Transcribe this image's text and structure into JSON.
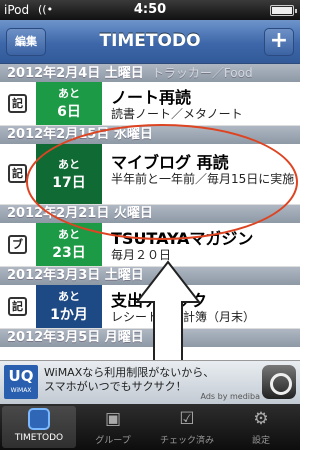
{
  "status": {
    "carrier": "iPod",
    "wifi_icon": "wifi-icon",
    "time": "4:50",
    "battery_icon": "battery-icon"
  },
  "nav": {
    "edit_label": "編集",
    "title": "TIMETODO",
    "add_label": "+"
  },
  "sections": [
    {
      "date": "2012年2月4日 土曜日",
      "overlay": "トラッカー／Food"
    },
    {
      "date": "2012年2月15日 水曜日"
    },
    {
      "date": "2012年2月21日 火曜日"
    },
    {
      "date": "2012年3月3日 土曜日"
    },
    {
      "date": "2012年3月5日 月曜日"
    }
  ],
  "items": [
    {
      "category": "記",
      "badge_top": "あと",
      "badge_value": "6日",
      "title": "ノート再読",
      "subtitle": "読書ノート／メタノート",
      "badge_color": "#1d9a46"
    },
    {
      "category": "記",
      "badge_top": "あと",
      "badge_value": "17日",
      "title": "マイブログ 再読",
      "subtitle": "半年前と一年前／毎月15日に実施",
      "badge_color": "#0f6a33"
    },
    {
      "category": "ブ",
      "badge_top": "あと",
      "badge_value": "23日",
      "title": "TSUTAYAマガジン",
      "subtitle": "毎月２０日",
      "badge_color": "#1d9a46"
    },
    {
      "category": "記",
      "badge_top": "あと",
      "badge_value": "1か月",
      "title": "支出チェック",
      "subtitle": "レシート／家計簿（月末）",
      "badge_color": "#1d4985"
    }
  ],
  "ad": {
    "logo_main": "UQ",
    "logo_sub": "WiMAX",
    "line1": "WiMAXなら利用制限がないから、",
    "line2": "スマホがいつでもサクサク！",
    "credit": "Ads by mediba"
  },
  "tabs": [
    {
      "label": "TIMETODO",
      "icon": "timetodo-icon"
    },
    {
      "label": "グループ",
      "icon": "group-icon"
    },
    {
      "label": "チェック済み",
      "icon": "checked-icon"
    },
    {
      "label": "設定",
      "icon": "settings-icon"
    }
  ]
}
